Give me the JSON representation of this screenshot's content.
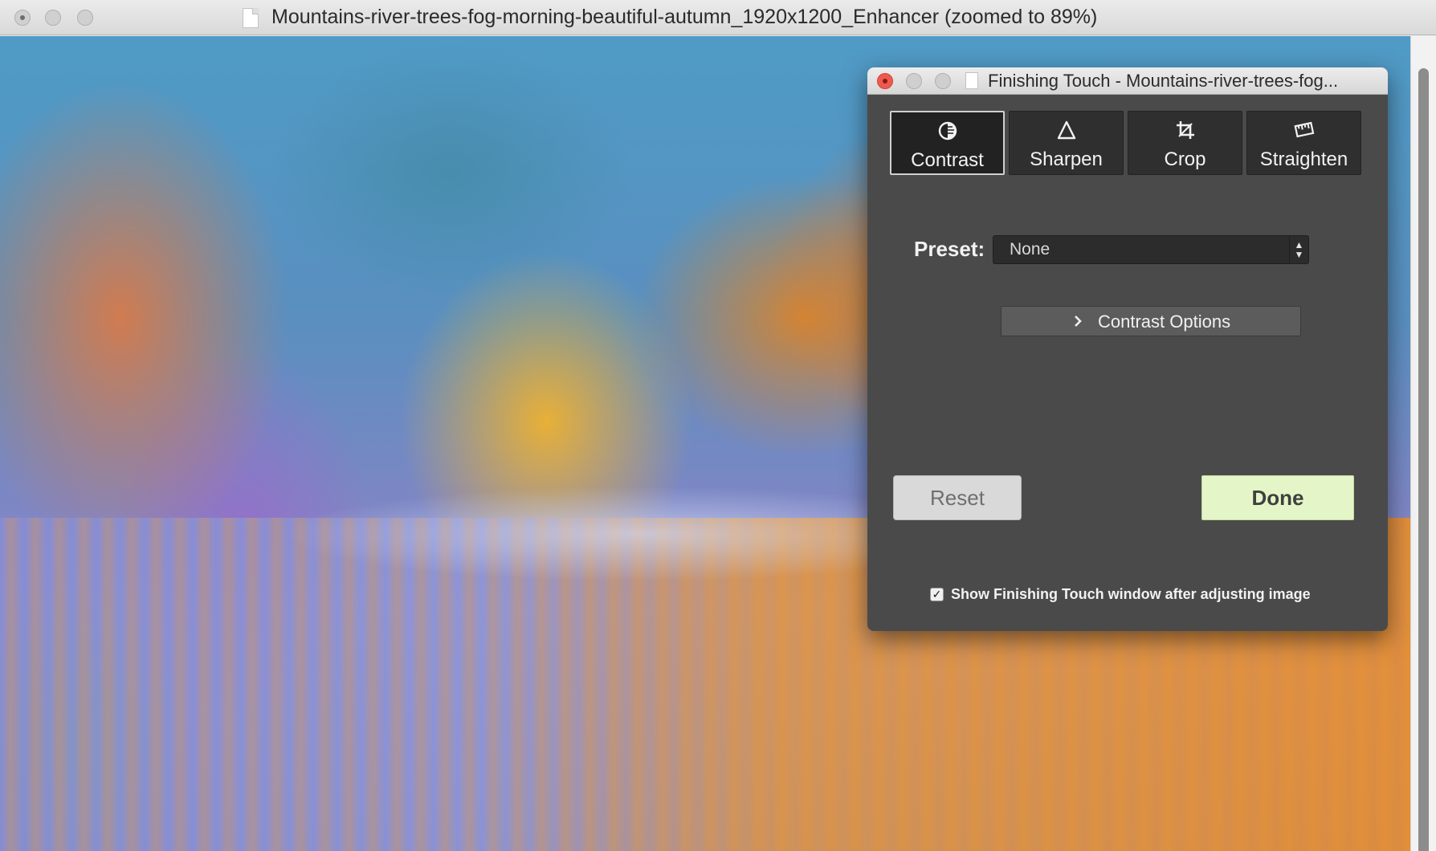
{
  "window": {
    "title": "Mountains-river-trees-fog-morning-beautiful-autumn_1920x1200_Enhancer (zoomed to 89%)"
  },
  "image": {
    "description_icon": "landscape-photo"
  },
  "panel": {
    "title": "Finishing Touch - Mountains-river-trees-fog...",
    "tabs": [
      {
        "label": "Contrast",
        "icon": "contrast-icon",
        "active": true
      },
      {
        "label": "Sharpen",
        "icon": "triangle-icon",
        "active": false
      },
      {
        "label": "Crop",
        "icon": "crop-icon",
        "active": false
      },
      {
        "label": "Straighten",
        "icon": "straighten-icon",
        "active": false
      }
    ],
    "preset": {
      "label": "Preset:",
      "value": "None"
    },
    "options_button": "Contrast Options",
    "reset_label": "Reset",
    "done_label": "Done",
    "checkbox": {
      "checked": true,
      "label": "Show Finishing Touch window after adjusting image"
    }
  },
  "colors": {
    "panel_bg": "#4a4a4a",
    "done_bg": "#e4f6c7",
    "close_red": "#ee5a4f"
  }
}
